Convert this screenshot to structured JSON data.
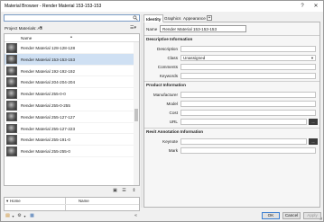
{
  "window": {
    "title": "Material Browser - Render Material 153-153-153",
    "help_label": "?",
    "close_label": "✕"
  },
  "left": {
    "search_placeholder": "",
    "library_label": "Project Materials: All",
    "list_header": "Name",
    "items": [
      {
        "label": "Render Material 128-128-128",
        "selected": false
      },
      {
        "label": "Render Material 153-153-153",
        "selected": true
      },
      {
        "label": "Render Material 192-192-192",
        "selected": false
      },
      {
        "label": "Render Material 204-204-204",
        "selected": false
      },
      {
        "label": "Render Material 255-0-0",
        "selected": false
      },
      {
        "label": "Render Material 255-0-255",
        "selected": false
      },
      {
        "label": "Render Material 255-127-127",
        "selected": false
      },
      {
        "label": "Render Material 255-127-223",
        "selected": false
      },
      {
        "label": "Render Material 255-191-0",
        "selected": false
      },
      {
        "label": "Render Material 255-255-0",
        "selected": false
      }
    ],
    "library_pane": {
      "left_header": "Home",
      "right_header": "Name"
    }
  },
  "right": {
    "tabs": [
      {
        "label": "Identity",
        "active": true
      },
      {
        "label": "Graphics",
        "active": false
      },
      {
        "label": "Appearance",
        "active": false
      }
    ],
    "tab_add_label": "+",
    "name_label": "Name",
    "name_value": "Render Material 153-153-153",
    "sections": {
      "descriptive": {
        "title": "Descriptive Information",
        "description_label": "Description",
        "description_value": "",
        "class_label": "Class",
        "class_value": "Unassigned",
        "comments_label": "Comments",
        "comments_value": "",
        "keywords_label": "Keywords",
        "keywords_value": ""
      },
      "product": {
        "title": "Product Information",
        "manufacturer_label": "Manufacturer",
        "manufacturer_value": "",
        "model_label": "Model",
        "model_value": "",
        "cost_label": "Cost",
        "cost_value": "",
        "url_label": "URL",
        "url_value": "",
        "browse_label": "..."
      },
      "annotation": {
        "title": "Revit Annotation Information",
        "keynote_label": "Keynote",
        "keynote_value": "",
        "browse_label": "...",
        "mark_label": "Mark",
        "mark_value": ""
      }
    }
  },
  "footer": {
    "ok_label": "OK",
    "cancel_label": "Cancel",
    "apply_label": "Apply"
  }
}
